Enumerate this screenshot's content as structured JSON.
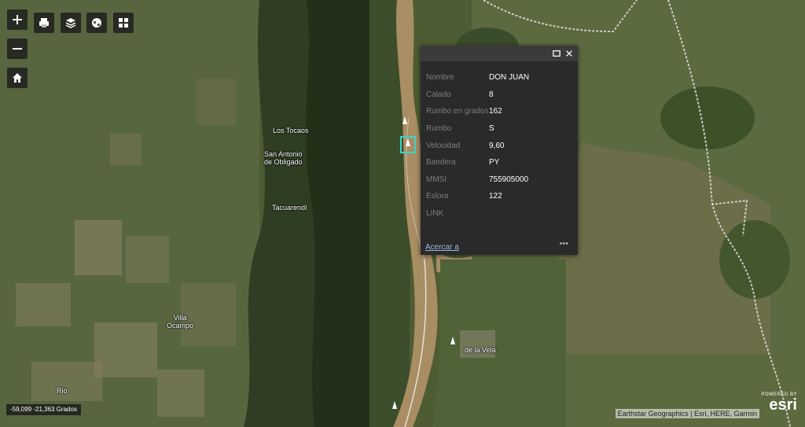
{
  "toolbar": {
    "zoom_in_icon": "plus-icon",
    "zoom_out_icon": "minus-icon",
    "home_icon": "home-icon",
    "print_icon": "printer-icon",
    "layers_icon": "layers-icon",
    "basemap_icon": "basemap-icon",
    "grid_icon": "grid-icon"
  },
  "places": {
    "los_tocaos": "Los Tocaos",
    "san_antonio": "San Antonio\nde Obligado",
    "tacuarendi": "Tacuarendí",
    "villa_ocampo": "Villa\nOcampo",
    "la_vela": "de la Vela",
    "bottom_left": "Rio"
  },
  "popup": {
    "rows": [
      {
        "key": "Nombre",
        "value": "DON JUAN"
      },
      {
        "key": "Calado",
        "value": "8"
      },
      {
        "key": "Rumbo en grados",
        "value": "162"
      },
      {
        "key": "Rumbo",
        "value": "S"
      },
      {
        "key": "Velocidad",
        "value": "9,60"
      },
      {
        "key": "Bandera",
        "value": "PY"
      },
      {
        "key": "MMSI",
        "value": "755905000"
      },
      {
        "key": "Eslora",
        "value": "122"
      },
      {
        "key": "LINK",
        "value": ""
      }
    ],
    "zoom_label": "Acercar a",
    "more_label": "•••",
    "maximize_icon": "maximize-icon",
    "close_icon": "close-icon"
  },
  "coordinates": "-59,099 -21,363 Grados",
  "attribution": "Earthstar Geographics | Esri, HERE, Garmin",
  "esri": {
    "powered_by": "POWERED BY",
    "logo": "esri"
  },
  "colors": {
    "river": "#a98d63",
    "vegetation_dark": "#2f4024",
    "vegetation": "#4b5e33",
    "popup_bg": "#2a2a2a",
    "selection": "#3fd1c8"
  }
}
